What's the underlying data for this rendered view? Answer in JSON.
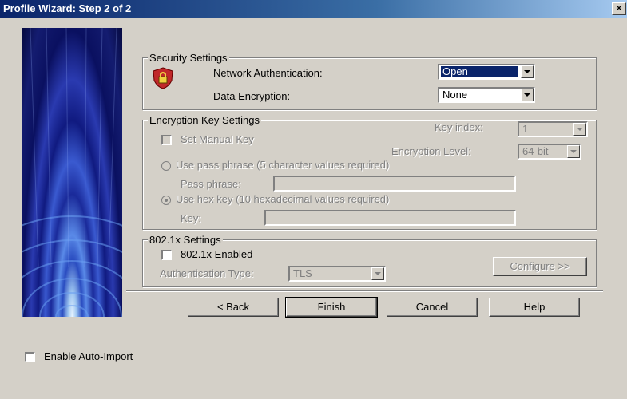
{
  "window": {
    "title": "Profile Wizard: Step 2 of 2",
    "close_glyph": "×"
  },
  "security": {
    "legend": "Security Settings",
    "icon": "security-shield-lock-icon",
    "network_auth_label": "Network Authentication:",
    "network_auth_value": "Open",
    "data_encryption_label": "Data Encryption:",
    "data_encryption_value": "None"
  },
  "encryption": {
    "legend": "Encryption Key Settings",
    "key_index_label": "Key index:",
    "key_index_value": "1",
    "set_manual_key_label": "Set Manual Key",
    "encryption_level_label": "Encryption Level:",
    "encryption_level_value": "64-bit",
    "pass_phrase_option_label": "Use pass phrase (5 character values required)",
    "pass_phrase_label": "Pass phrase:",
    "hex_key_option_label": "Use hex key (10 hexadecimal values required)",
    "key_label": "Key:"
  },
  "dot1x": {
    "legend": "802.1x Settings",
    "enabled_label": "802.1x Enabled",
    "auth_type_label": "Authentication Type:",
    "auth_type_value": "TLS",
    "configure_label": "Configure >>"
  },
  "buttons": {
    "back": "< Back",
    "finish": "Finish",
    "cancel": "Cancel",
    "help": "Help"
  },
  "auto_import_label": "Enable Auto-Import",
  "colors": {
    "title_start": "#0a246a",
    "title_end": "#a6caf0",
    "face": "#d4d0c8",
    "selection": "#0a246a"
  }
}
